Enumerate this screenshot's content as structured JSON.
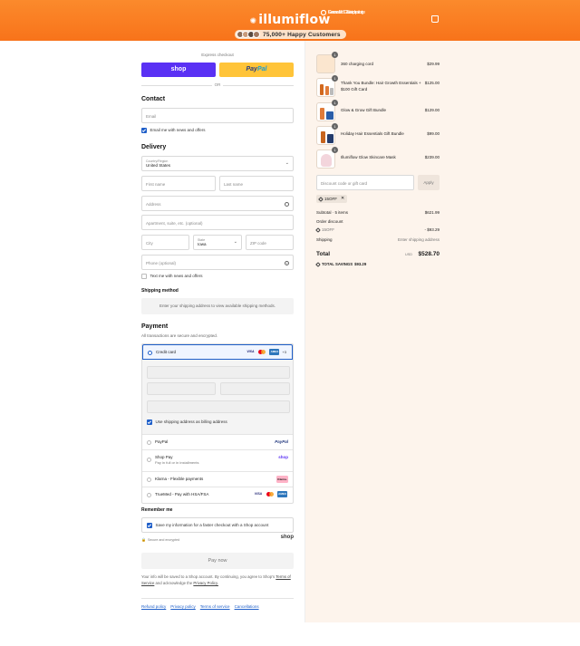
{
  "topbar": {
    "items": [
      "Free US Shipping",
      "Growth Guarantee",
      "Secure Checkout"
    ]
  },
  "brand": {
    "name": "illumiflow"
  },
  "header": {
    "happy_customers": "75,000+ Happy Customers"
  },
  "express": {
    "label": "Express checkout",
    "shop_label": "shop",
    "paypal_label_a": "Pay",
    "paypal_label_b": "Pal",
    "or": "OR"
  },
  "contact": {
    "heading": "Contact",
    "email_placeholder": "Email",
    "newsletter_label": "Email me with news and offers"
  },
  "delivery": {
    "heading": "Delivery",
    "country_label": "Country/Region",
    "country_value": "United States",
    "first_name": "First name",
    "last_name": "Last name",
    "address": "Address",
    "apartment": "Apartment, suite, etc. (optional)",
    "city": "City",
    "state_label": "State",
    "state_value": "Iowa",
    "zip": "ZIP code",
    "phone": "Phone (optional)",
    "sms_label": "Text me with news and offers"
  },
  "shipping": {
    "heading": "Shipping method",
    "info": "Enter your shipping address to view available shipping methods."
  },
  "payment": {
    "heading": "Payment",
    "subtitle": "All transactions are secure and encrypted.",
    "credit_card": "Credit card",
    "more_cards": "+3",
    "billing_same": "Use shipping address as billing address",
    "paypal": "PayPal",
    "paypal_logo": "PayPal",
    "shop_pay": "Shop Pay",
    "shop_pay_sub": "Pay in full or in installments",
    "shop_logo": "shop",
    "klarna": "Klarna - Flexible payments",
    "klarna_logo": "Klarna.",
    "truemed": "TrueMed - Pay with HSA/FSA"
  },
  "remember": {
    "heading": "Remember me",
    "save_label": "Save my information for a faster checkout with a Shop account",
    "secure": "Secure and encrypted",
    "shop_logo": "shop"
  },
  "actions": {
    "pay_now": "Pay now"
  },
  "legal": {
    "text_a": "Your info will be saved to a Shop account. By continuing, you agree to Shop’s",
    "terms": "Terms of Service",
    "text_b": "and acknowledge the",
    "privacy": "Privacy Policy."
  },
  "footer": {
    "links": [
      "Refund policy",
      "Privacy policy",
      "Terms of service",
      "Cancellations"
    ]
  },
  "cart": {
    "items": [
      {
        "qty": "1",
        "name": "360 charging cord",
        "price": "$29.99"
      },
      {
        "qty": "1",
        "name": "Thank You Bundle: Hair Growth Essentials + $100 Gift Card",
        "price": "$125.00"
      },
      {
        "qty": "1",
        "name": "Glow & Grow Gift Bundle",
        "price": "$129.00"
      },
      {
        "qty": "1",
        "name": "Holiday Hair Essentials Gift Bundle",
        "price": "$99.00"
      },
      {
        "qty": "1",
        "name": "Illumiflow Glow Skincare Mask",
        "price": "$239.00"
      }
    ],
    "discount_placeholder": "Discount code or gift card",
    "apply": "Apply",
    "applied_code": "15OFF",
    "subtotal_label": "Subtotal · 5 items",
    "subtotal_value": "$621.99",
    "order_discount_label": "Order discount",
    "discount_code": "15OFF",
    "discount_value": "- $93.29",
    "shipping_label": "Shipping",
    "shipping_value": "Enter shipping address",
    "total_label": "Total",
    "currency": "USD",
    "total_value": "$528.70",
    "savings_label": "TOTAL SAVINGS",
    "savings_value": "$93.29"
  },
  "colors": {
    "header": "#f8731a",
    "shop": "#5a31f4",
    "paypal": "#ffc439",
    "accent": "#1f5fc9",
    "sidebar": "#fdf4ec"
  }
}
